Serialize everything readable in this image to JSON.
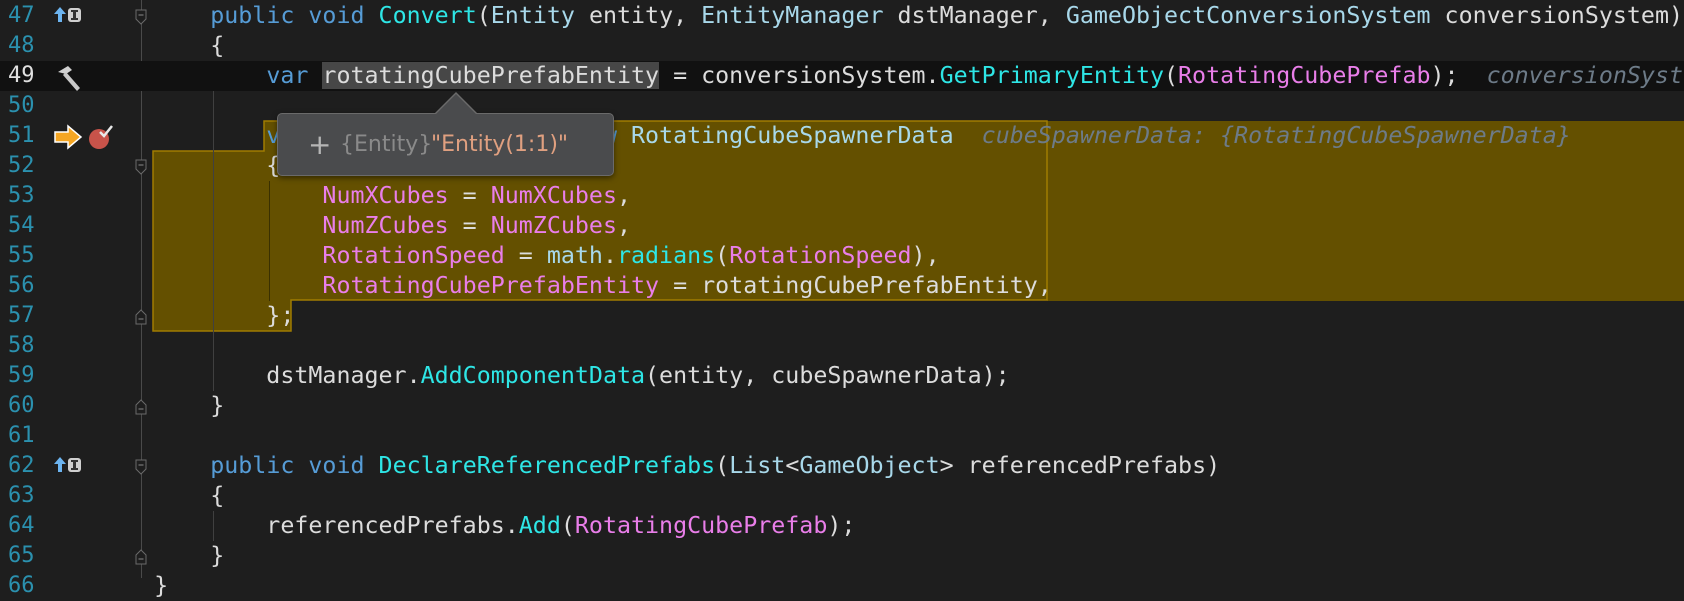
{
  "colors": {
    "background": "#1e1e1e",
    "keyword": "#569cd6",
    "method": "#2ee6e6",
    "type": "#a8d8ea",
    "field": "#e97ee9",
    "identifier": "#dcdcdc",
    "inline_hint": "#6d7b88",
    "line_number": "#2b91af",
    "highlight_fill": "#645000",
    "highlight_border": "#a07c00",
    "breakpoint": "#c8534a",
    "execution_pointer": "#f5a623"
  },
  "current_line": 49,
  "lines": [
    {
      "num": "47",
      "icons": [
        "override-up-arrow-icon"
      ],
      "fold": "start",
      "tokens": [
        [
          "id",
          "        "
        ],
        [
          "kw",
          "public"
        ],
        [
          "id",
          " "
        ],
        [
          "kw",
          "void"
        ],
        [
          "id",
          " "
        ],
        [
          "fn",
          "Convert"
        ],
        [
          "id",
          "("
        ],
        [
          "ty",
          "Entity"
        ],
        [
          "id",
          " entity, "
        ],
        [
          "ty",
          "EntityManager"
        ],
        [
          "id",
          " dstManager, "
        ],
        [
          "ty",
          "GameObjectConversionSystem"
        ],
        [
          "id",
          " conversionSystem)"
        ]
      ]
    },
    {
      "num": "48",
      "tokens": [
        [
          "id",
          "        {"
        ]
      ]
    },
    {
      "num": "49",
      "icons": [
        "hammer-icon"
      ],
      "tokens": [
        [
          "id",
          "            "
        ],
        [
          "kw",
          "var"
        ],
        [
          "id",
          " "
        ],
        [
          "sel",
          "rotatingCubePrefabEntity"
        ],
        [
          "id",
          " = conversionSystem."
        ],
        [
          "fn",
          "GetPrimaryEntity"
        ],
        [
          "id",
          "("
        ],
        [
          "prop",
          "RotatingCubePrefab"
        ],
        [
          "id",
          ");  "
        ],
        [
          "hint",
          "conversionSyste"
        ]
      ]
    },
    {
      "num": "50",
      "tokens": []
    },
    {
      "num": "51",
      "icons": [
        "execution-pointer-arrow-icon",
        "breakpoint-icon"
      ],
      "tokens": [
        [
          "id",
          "            "
        ],
        [
          "kw",
          "var"
        ],
        [
          "id",
          " cubeSpawnerData = "
        ],
        [
          "kw",
          "new"
        ],
        [
          "id",
          " "
        ],
        [
          "ty",
          "RotatingCubeSpawnerData"
        ],
        [
          "id",
          "  "
        ],
        [
          "hint",
          "cubeSpawnerData: {RotatingCubeSpawnerData}"
        ]
      ]
    },
    {
      "num": "52",
      "fold": "start",
      "tokens": [
        [
          "id",
          "            {"
        ]
      ]
    },
    {
      "num": "53",
      "tokens": [
        [
          "id",
          "                "
        ],
        [
          "prop",
          "NumXCubes"
        ],
        [
          "id",
          " = "
        ],
        [
          "prop",
          "NumXCubes"
        ],
        [
          "id",
          ","
        ]
      ]
    },
    {
      "num": "54",
      "tokens": [
        [
          "id",
          "                "
        ],
        [
          "prop",
          "NumZCubes"
        ],
        [
          "id",
          " = "
        ],
        [
          "prop",
          "NumZCubes"
        ],
        [
          "id",
          ","
        ]
      ]
    },
    {
      "num": "55",
      "tokens": [
        [
          "id",
          "                "
        ],
        [
          "prop",
          "RotationSpeed"
        ],
        [
          "id",
          " = "
        ],
        [
          "ty",
          "math"
        ],
        [
          "id",
          "."
        ],
        [
          "fn",
          "radians"
        ],
        [
          "id",
          "("
        ],
        [
          "prop",
          "RotationSpeed"
        ],
        [
          "id",
          "),"
        ]
      ]
    },
    {
      "num": "56",
      "tokens": [
        [
          "id",
          "                "
        ],
        [
          "prop",
          "RotatingCubePrefabEntity"
        ],
        [
          "id",
          " = rotatingCubePrefabEntity,"
        ]
      ]
    },
    {
      "num": "57",
      "fold": "end",
      "tokens": [
        [
          "id",
          "            };"
        ]
      ]
    },
    {
      "num": "58",
      "tokens": []
    },
    {
      "num": "59",
      "tokens": [
        [
          "id",
          "            dstManager."
        ],
        [
          "fn",
          "AddComponentData"
        ],
        [
          "id",
          "(entity, cubeSpawnerData);"
        ]
      ]
    },
    {
      "num": "60",
      "fold": "end",
      "tokens": [
        [
          "id",
          "        }"
        ]
      ]
    },
    {
      "num": "61",
      "tokens": []
    },
    {
      "num": "62",
      "icons": [
        "override-up-arrow-icon"
      ],
      "fold": "start",
      "tokens": [
        [
          "id",
          "        "
        ],
        [
          "kw",
          "public"
        ],
        [
          "id",
          " "
        ],
        [
          "kw",
          "void"
        ],
        [
          "id",
          " "
        ],
        [
          "fn",
          "DeclareReferencedPrefabs"
        ],
        [
          "id",
          "("
        ],
        [
          "ty",
          "List"
        ],
        [
          "id",
          "<"
        ],
        [
          "ty",
          "GameObject"
        ],
        [
          "id",
          "> referencedPrefabs)"
        ]
      ]
    },
    {
      "num": "63",
      "tokens": [
        [
          "id",
          "        {"
        ]
      ]
    },
    {
      "num": "64",
      "tokens": [
        [
          "id",
          "            referencedPrefabs."
        ],
        [
          "fn",
          "Add"
        ],
        [
          "id",
          "("
        ],
        [
          "prop",
          "RotatingCubePrefab"
        ],
        [
          "id",
          ");"
        ]
      ]
    },
    {
      "num": "65",
      "fold": "end",
      "tokens": [
        [
          "id",
          "        }"
        ]
      ]
    },
    {
      "num": "66",
      "tokens": [
        [
          "id",
          "    }"
        ]
      ]
    }
  ],
  "datatip": {
    "expand_icon": "plus-icon",
    "expand_label": "+",
    "type": "{Entity}",
    "value": "\"Entity(1:1)\""
  }
}
